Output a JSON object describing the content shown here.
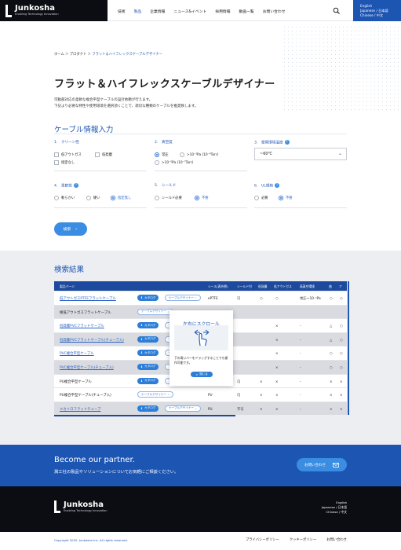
{
  "header": {
    "logo_name": "Junkosha",
    "logo_tagline": "Enabling Technology Innovation",
    "nav": [
      "技術",
      "製品",
      "企業情報",
      "ニュース&イベント",
      "採用情報",
      "動画一覧",
      "お問い合わせ"
    ],
    "lang": [
      "English",
      "Japanese / 日本語",
      "Chinese / 中文"
    ]
  },
  "breadcrumb": {
    "home": "ホーム",
    "products": "プロダクト",
    "current": "フラット＆ハイフレックスケーブルデザイナー"
  },
  "page": {
    "title": "フラット＆ハイフレックスケーブルデザイナー",
    "lead1": "可動部対応の柔軟な複合平型ケーブルの設計依頼が行えます。",
    "lead2": "下記より必要な特性や使用環境を選択頂くことで、適切な種類のケーブルを推奨致します。"
  },
  "form": {
    "section": "ケーブル情報入力",
    "q1": "1.　クリーン性",
    "q1_opts": [
      "低アウトガス",
      "低発塵",
      "指定なし"
    ],
    "q2": "2.　真空度",
    "q2_opts": [
      "常圧",
      ">10⁻²Pa (10⁻⁴Torr)",
      ">10⁻⁵Pa (10⁻⁷Torr)"
    ],
    "q3": "3.　使用環境温度",
    "q3_value": "~60℃",
    "q4": "4.　柔軟性",
    "q4_opts": [
      "軟らかい",
      "硬い",
      "指定無し"
    ],
    "q5": "5.　シールド",
    "q5_opts": [
      "シールド必要",
      "不要"
    ],
    "q6": "6.　UL規格",
    "q6_opts": [
      "必要",
      "不要"
    ],
    "search": "検索"
  },
  "results": {
    "title": "検索結果",
    "headers": [
      "製品ページ",
      "シース(表外層)",
      "シールド付",
      "低発塵",
      "低アウトガス",
      "高真空環境",
      "曲",
      "ア"
    ],
    "tag_catalog": "カタログ",
    "tag_designer": "ケーブルデザイナー",
    "rows": [
      {
        "name": "低アウトガスPTFEフラットケーブル",
        "sheath": "ePTFE",
        "shield": "可",
        "dust": "○",
        "gas": "○",
        "vac": "常圧～10⁻⁵Pa",
        "b": "○",
        "a": "○"
      },
      {
        "name": "極低アウトガスフラットケーブル",
        "sheath": "",
        "shield": "",
        "dust": "",
        "gas": "",
        "vac": "",
        "b": "",
        "a": ""
      },
      {
        "name": "低発塵PVCフラットケーブル",
        "sheath": "",
        "shield": "",
        "dust": "",
        "gas": "×",
        "vac": "-",
        "b": "△",
        "a": "○"
      },
      {
        "name": "低発塵PVCフラットケーブル(チューブ入)",
        "sheath": "",
        "shield": "",
        "dust": "",
        "gas": "×",
        "vac": "-",
        "b": "△",
        "a": "○"
      },
      {
        "name": "PVC複合平型ケーブル",
        "sheath": "",
        "shield": "",
        "dust": "",
        "gas": "×",
        "vac": "-",
        "b": "○",
        "a": "○"
      },
      {
        "name": "PVC複合平型ケーブル(チューブ入)",
        "sheath": "",
        "shield": "",
        "dust": "",
        "gas": "×",
        "vac": "-",
        "b": "○",
        "a": "○"
      },
      {
        "name": "PU複合平型ケーブル",
        "sheath": "PU",
        "shield": "可",
        "dust": "×",
        "gas": "×",
        "vac": "-",
        "b": "×",
        "a": "×"
      },
      {
        "name": "PU複合平型ケーブル(チューブ入)",
        "sheath": "PU",
        "shield": "可",
        "dust": "×",
        "gas": "×",
        "vac": "-",
        "b": "×",
        "a": "×"
      },
      {
        "name": "メカトロフラットチューブ",
        "sheath": "PU",
        "shield": "不可",
        "dust": "×",
        "gas": "×",
        "vac": "-",
        "b": "×",
        "a": "×"
      }
    ]
  },
  "modal": {
    "title": "左右にスクロール",
    "text": "下の青いバーをドラッグすることでも操作可能です。",
    "close": "閉じる"
  },
  "partner": {
    "title": "Become our partner.",
    "subtitle": "潤工社の製品やソリューションについてお気軽にご相談ください。",
    "button": "お問い合わせ"
  },
  "footer": {
    "lang": [
      "English",
      "Japanese / 日本語",
      "Chinese / 中文"
    ],
    "copyright": "Copyright 2020. Junkosha Inc. All rights reserved.",
    "links": [
      "プライバシーポリシー",
      "クッキーポリシー",
      "お問い合わせ"
    ]
  },
  "colors": {
    "brand": "#1d55b3",
    "accent": "#3a8de3",
    "dark": "#0b0d13"
  }
}
